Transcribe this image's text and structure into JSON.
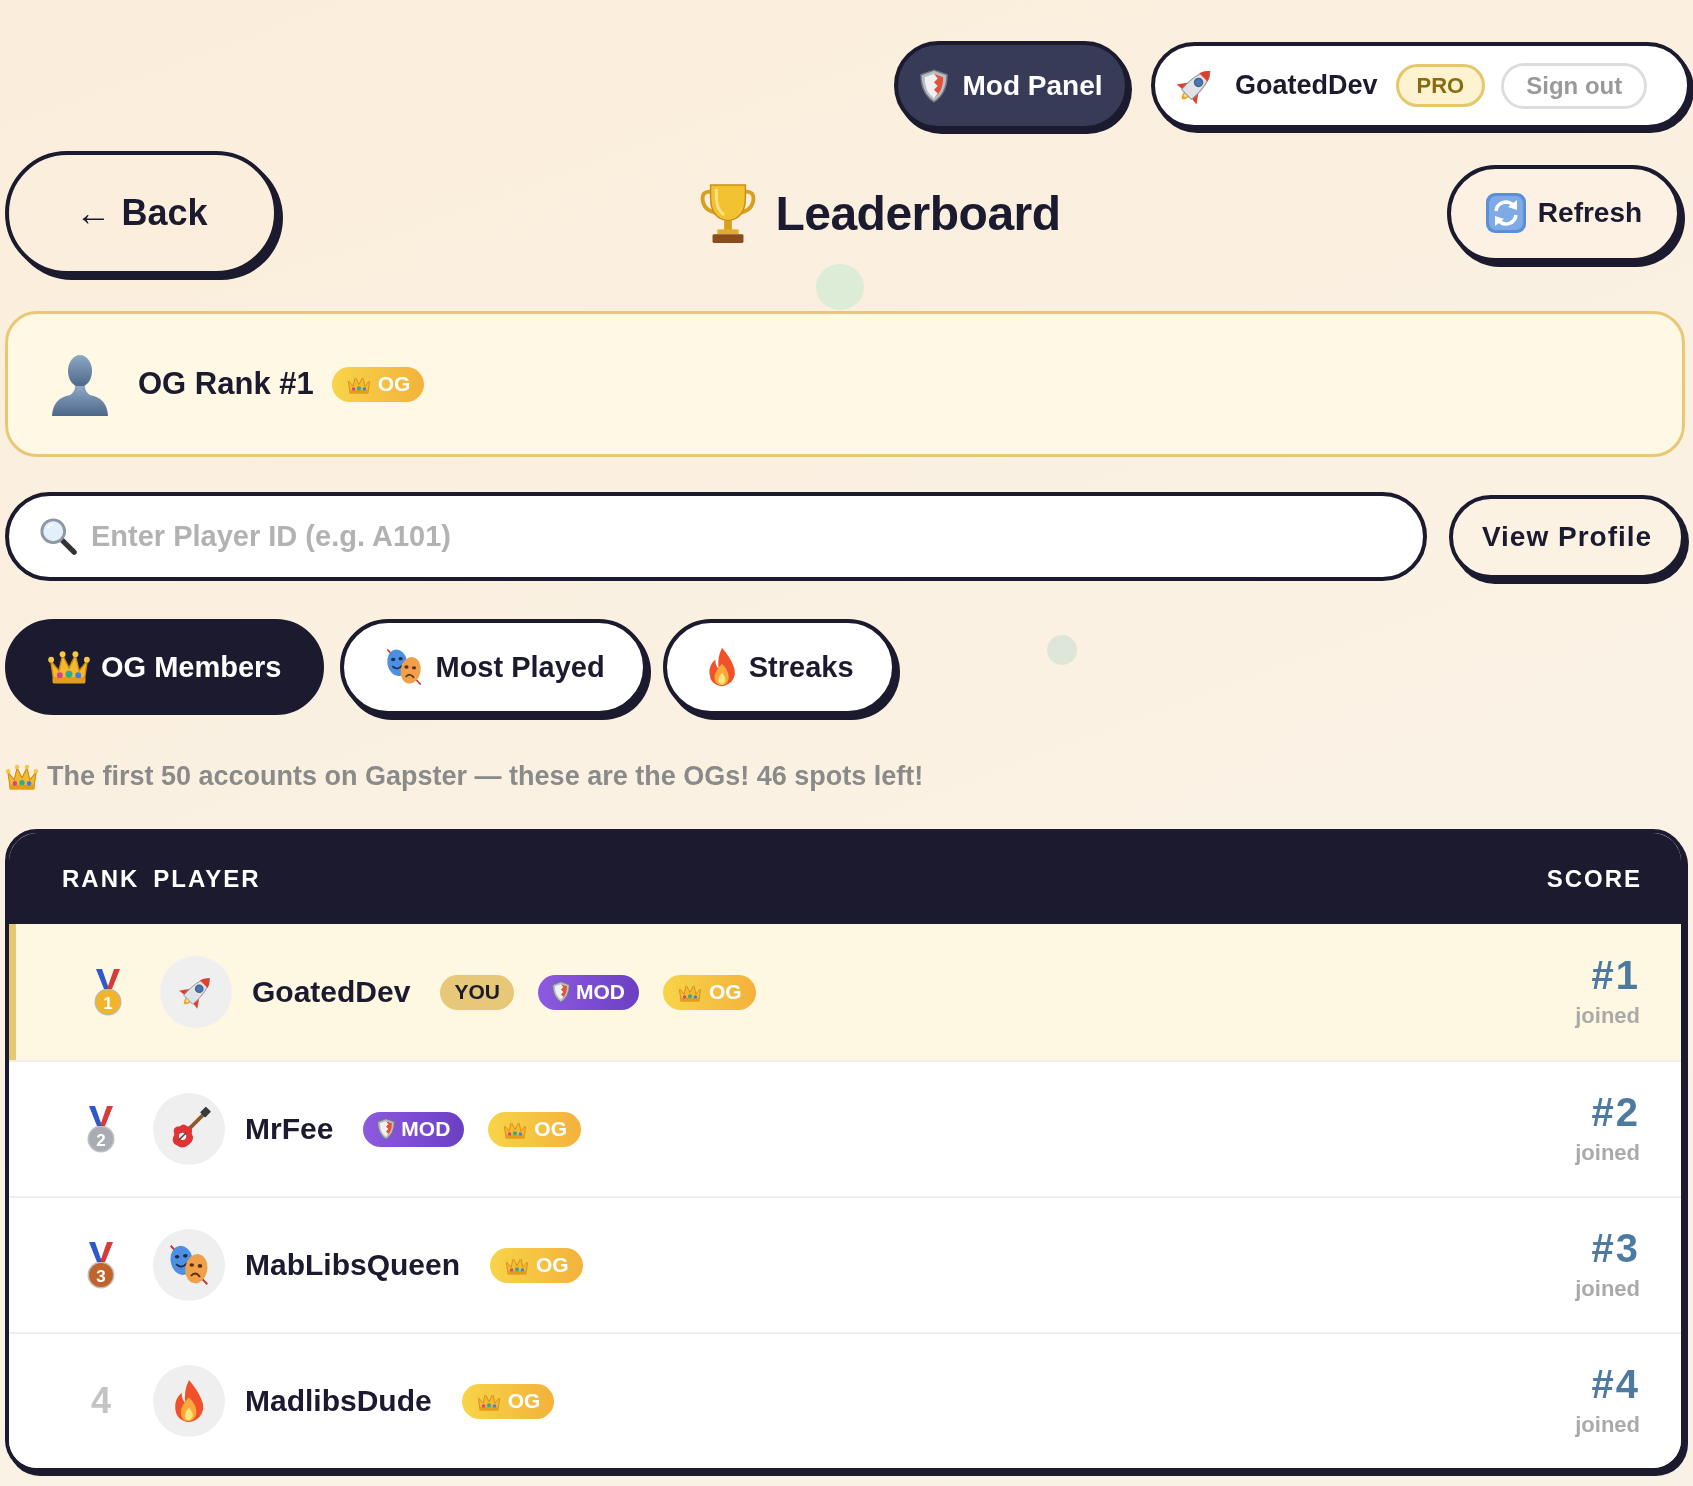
{
  "top_bar": {
    "mod_panel_button": "Mod Panel",
    "user": {
      "name": "GoatedDev",
      "plan": "PRO",
      "sign_out": "Sign out"
    }
  },
  "header": {
    "back_button": "← Back",
    "title": "Leaderboard",
    "refresh_button": "Refresh"
  },
  "og_rank_card": {
    "label": "OG Rank #1",
    "badge": "OG"
  },
  "search": {
    "placeholder": "Enter Player ID (e.g. A101)",
    "button": "View Profile"
  },
  "tabs": [
    {
      "label": "OG Members",
      "selected": true
    },
    {
      "label": "Most Played",
      "selected": false
    },
    {
      "label": "Streaks",
      "selected": false
    }
  ],
  "info_text": "The first 50 accounts on Gapster — these are the OGs! 46 spots left!",
  "table": {
    "columns": [
      "RANK",
      "PLAYER",
      "SCORE"
    ],
    "rows": [
      {
        "rank": "1",
        "color": "#f2b52a",
        "name": "GoatedDev",
        "highlighted": true,
        "badges": [
          {
            "kind": "you",
            "label": "YOU"
          },
          {
            "kind": "mod",
            "label": "MOD"
          },
          {
            "kind": "og",
            "label": "OG"
          }
        ],
        "score": "#1",
        "score_note": "joined"
      },
      {
        "rank": "2",
        "color": "#a9adb3",
        "name": "MrFee",
        "highlighted": false,
        "badges": [
          {
            "kind": "mod",
            "label": "MOD"
          },
          {
            "kind": "og",
            "label": "OG"
          }
        ],
        "score": "#2",
        "score_note": "joined"
      },
      {
        "rank": "3",
        "color": "#c0642c",
        "name": "MabLibsQueen",
        "highlighted": false,
        "badges": [
          {
            "kind": "og",
            "label": "OG"
          }
        ],
        "score": "#3",
        "score_note": "joined"
      },
      {
        "rank": "4",
        "name": "MadlibsDude",
        "highlighted": false,
        "badges": [
          {
            "kind": "og",
            "label": "OG"
          }
        ],
        "score": "#4",
        "score_note": "joined"
      }
    ]
  }
}
